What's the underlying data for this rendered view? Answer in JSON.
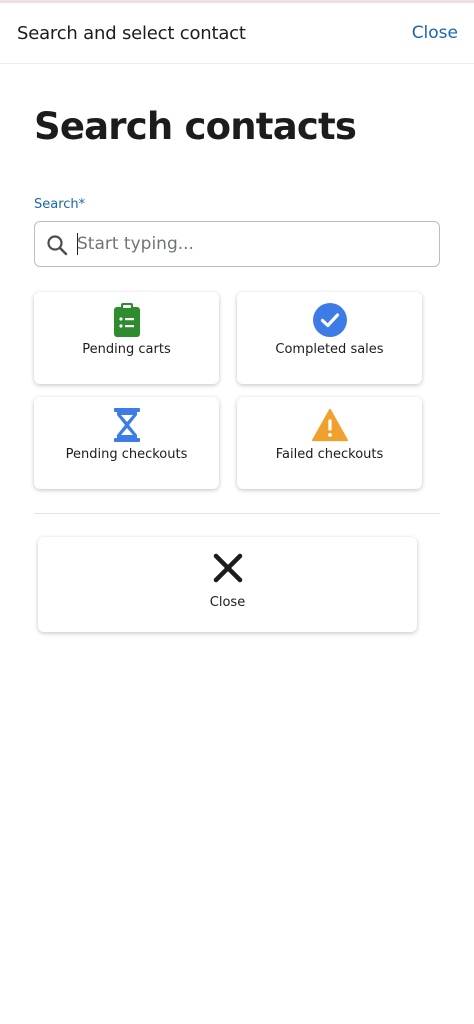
{
  "header": {
    "title": "Search and select contact",
    "close_label": "Close"
  },
  "page": {
    "title": "Search contacts"
  },
  "search": {
    "label": "Search*",
    "placeholder": "Start typing...",
    "value": ""
  },
  "tiles": [
    {
      "label": "Pending carts",
      "icon": "clipboard-list-icon",
      "color": "#2e8b2e"
    },
    {
      "label": "Completed sales",
      "icon": "check-circle-icon",
      "color": "#3d7be6"
    },
    {
      "label": "Pending checkouts",
      "icon": "hourglass-icon",
      "color": "#3d7be6"
    },
    {
      "label": "Failed checkouts",
      "icon": "warning-triangle-icon",
      "color": "#f0a02c"
    }
  ],
  "close_tile": {
    "label": "Close",
    "icon": "close-icon"
  },
  "colors": {
    "accent": "#1a66b0",
    "text": "#1c1c1e"
  }
}
